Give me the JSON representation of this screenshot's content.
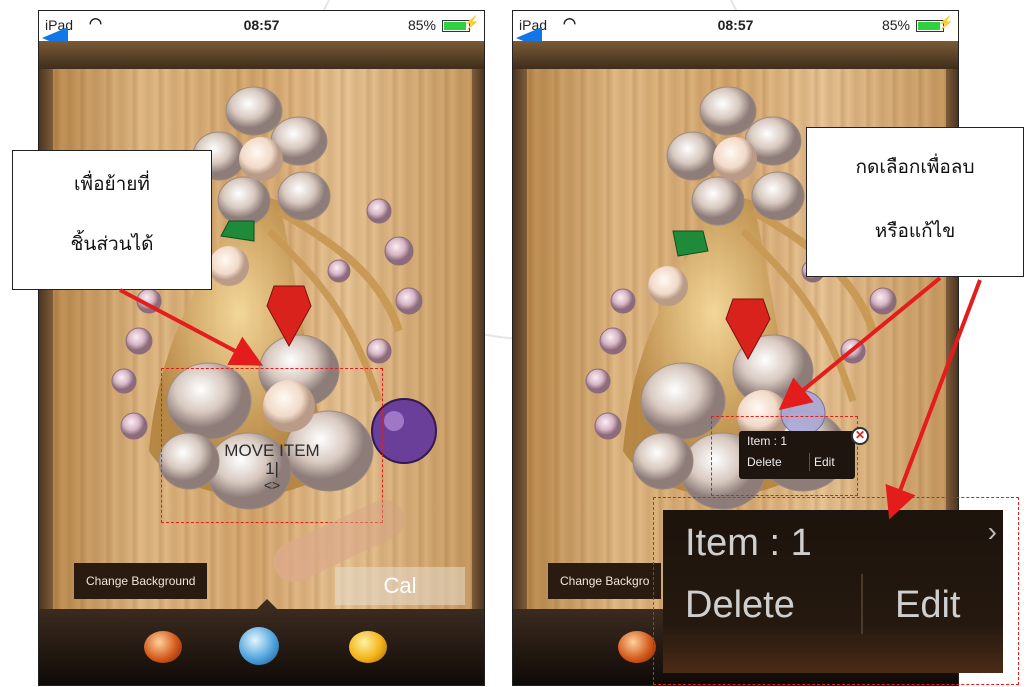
{
  "status_bar": {
    "carrier": "iPad",
    "time": "08:57",
    "battery": "85%",
    "battery_level": 0.85
  },
  "left_screen": {
    "move_label_line1": "MOVE ITEM",
    "move_label_line2": "1|",
    "move_label_line3": "<>",
    "change_background": "Change Background",
    "cal_button": "Cal",
    "callout_line1": "เพื่อย้ายที่",
    "callout_line2": "ชิ้นส่วนได้"
  },
  "right_screen": {
    "change_background": "Change Backgro",
    "popup_title": "Item : 1",
    "popup_delete": "Delete",
    "popup_edit": "Edit",
    "callout_line1": "กดเลือกเพื่อลบ",
    "callout_line2": "หรือแก้ไข",
    "zoom_title": "Item : 1",
    "zoom_delete": "Delete",
    "zoom_edit": "Edit"
  },
  "dock_gems": [
    "orange-gem-icon",
    "blue-gem-icon",
    "yellow-gem-icon"
  ],
  "colors": {
    "annotation_red": "#e41c1c",
    "back_arrow_blue": "#1176e8",
    "popup_bg": "#1d150e"
  }
}
